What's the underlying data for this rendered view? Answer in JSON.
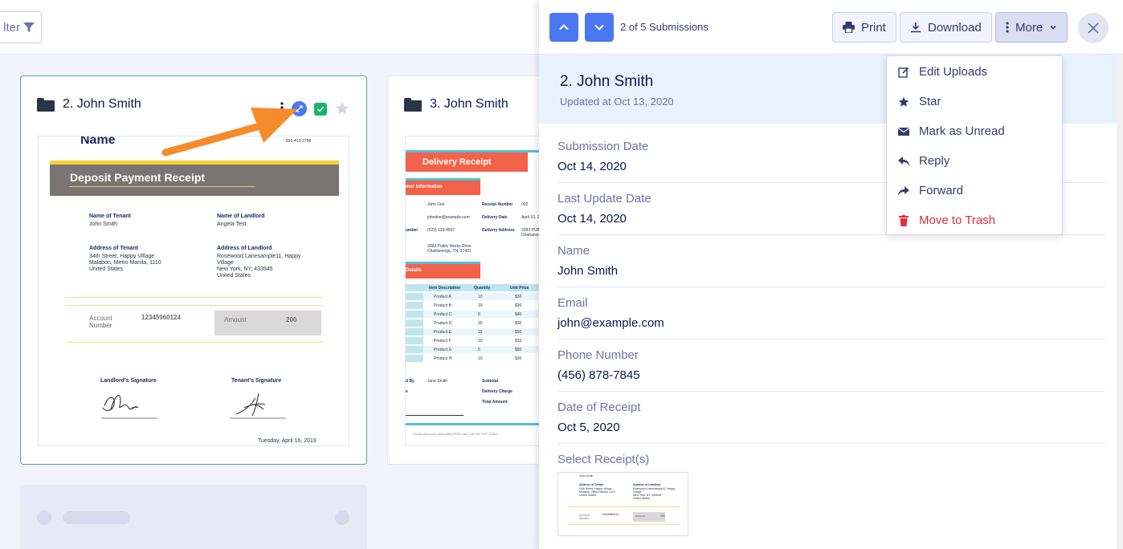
{
  "toolbar": {
    "filter_label": "lter"
  },
  "cards": [
    {
      "title": "2. John Smith",
      "doc": {
        "name_heading": "Name",
        "phone": "816-413-2798",
        "receipt_title": "Deposit Payment Receipt",
        "tenant_label": "Name of Tenant",
        "tenant_value": "John Smith",
        "landlord_label": "Name of Landlord",
        "landlord_value": "Angela Test",
        "addr_tenant_label": "Address of Tenant",
        "addr_tenant_1": "34th Street, Happy Village",
        "addr_tenant_2": "Malabon, Metro Manila, 1110",
        "addr_tenant_3": "United States",
        "addr_landlord_label": "Address of Landlord",
        "addr_landlord_1": "Rosewood Lanesample11, Happy",
        "addr_landlord_2": "Village",
        "addr_landlord_3": "New York, NY, 433545",
        "addr_landlord_4": "United States",
        "account_label_1": "Account",
        "account_label_2": "Number",
        "account_value": "12345960124",
        "amount_label": "Amount",
        "amount_value": "200",
        "sig_landlord": "Landlord's Signature",
        "sig_tenant": "Tenant's Signature",
        "date": "Tuesday, April 16, 2019"
      }
    },
    {
      "title": "3. John Smith",
      "doc": {
        "receipt_title": "Delivery Receipt",
        "section1": "mer Information",
        "section2": "Details",
        "r1": "John Doe",
        "r2": "johndoe@example.com",
        "r3": "(523) 123-4567",
        "r4": "3383 Public Works Drive",
        "r5": "Chattanooga, TN, 37421",
        "lbl_receipt": "Receipt Number",
        "val_receipt": "002",
        "lbl_delivery": "Delivery Date",
        "val_delivery": "April 10, 2",
        "lbl_addr": "Delivery Address",
        "val_addr": "3383 PUBLIC",
        "val_addr2": "Chattanoo",
        "umber": "umber",
        "col1": "Item Description",
        "col2": "Quantity",
        "col3": "Unit Price",
        "items": [
          [
            "Product A",
            "10",
            "$30"
          ],
          [
            "Product B",
            "10",
            "$30"
          ],
          [
            "Product C",
            "5",
            "$40"
          ],
          [
            "Product D",
            "20",
            "$30"
          ],
          [
            "Product E",
            "15",
            "$50"
          ],
          [
            "Product F",
            "10",
            "$15"
          ],
          [
            "Product G",
            "5",
            "$50"
          ],
          [
            "Product H",
            "10",
            "$30"
          ]
        ],
        "ed_by": "d By",
        "ed_by_val": "Jane Smith",
        "e": "e",
        "subtotal": "Subtotal",
        "delivery_charge": "Delivery Charge",
        "total": "Total Amount",
        "footer": "Create your own automated PDFs with JotForm PDF Editor"
      }
    }
  ],
  "panel": {
    "counter": "2 of 5 Submissions",
    "print_label": "Print",
    "download_label": "Download",
    "more_label": "More",
    "title": "2. John Smith",
    "updated": "Updated at Oct 13, 2020",
    "fields": [
      {
        "label": "Submission Date",
        "value": "Oct 14, 2020"
      },
      {
        "label": "Last Update Date",
        "value": "Oct 14, 2020"
      },
      {
        "label": "Name",
        "value": "John Smith"
      },
      {
        "label": "Email",
        "value": "john@example.com"
      },
      {
        "label": "Phone Number",
        "value": "(456) 878-7845"
      },
      {
        "label": "Date of Receipt",
        "value": "Oct 5, 2020"
      }
    ],
    "receipt_label": "Select Receipt(s)",
    "thumb": {
      "a": "John Smith",
      "b": "Address of Tenant",
      "c": "34th Street, Happy Village",
      "d": "Malabon, Metro Manila, 1110",
      "e": "United States",
      "f": "Address of Landlord",
      "g": "Rosewood Lanesample11, Happy",
      "h": "Village",
      "i": "New York, NY, 433545",
      "j": "United States",
      "k": "Account",
      "l": "Number",
      "m": "12345960124",
      "n": "Amount",
      "o": "200"
    }
  },
  "menu": {
    "items": [
      {
        "label": "Edit Uploads",
        "icon": "edit-icon"
      },
      {
        "label": "Star",
        "icon": "star-icon"
      },
      {
        "label": "Mark as Unread",
        "icon": "envelope-icon"
      },
      {
        "label": "Reply",
        "icon": "reply-icon"
      },
      {
        "label": "Forward",
        "icon": "forward-icon"
      },
      {
        "label": "Move to Trash",
        "icon": "trash-icon"
      }
    ]
  },
  "colors": {
    "accent": "#4c77f2",
    "danger": "#e52a3d",
    "arrow": "#f68b2c",
    "selected_border": "#4fb37f"
  }
}
